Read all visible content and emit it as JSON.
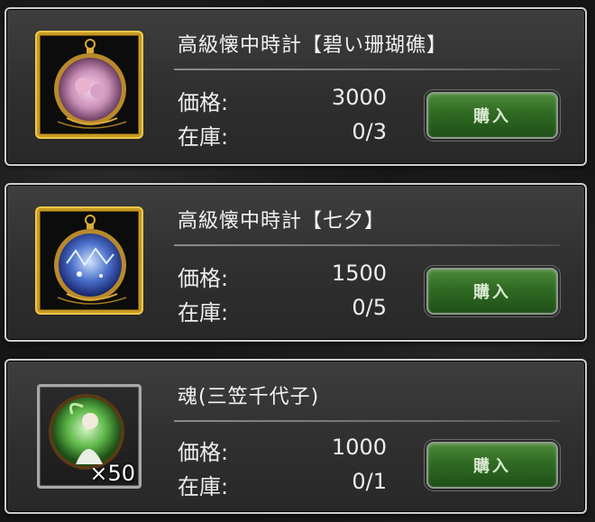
{
  "labels": {
    "price": "価格:",
    "stock": "在庫:"
  },
  "items": [
    {
      "name": "高級懐中時計【碧い珊瑚礁】",
      "price": "3000",
      "stock": "0/3",
      "buy_label": "購入",
      "icon": "pocket-watch-pink-icon"
    },
    {
      "name": "高級懐中時計【七夕】",
      "price": "1500",
      "stock": "0/5",
      "buy_label": "購入",
      "icon": "pocket-watch-blue-icon"
    },
    {
      "name": "魂(三笠千代子)",
      "price": "1000",
      "stock": "0/1",
      "buy_label": "購入",
      "quantity": "×50",
      "icon": "soul-portrait-icon"
    }
  ],
  "colors": {
    "buy_button": "#2f6a22",
    "gold_frame": "#c79a22",
    "card_border": "#cfcfcf"
  }
}
